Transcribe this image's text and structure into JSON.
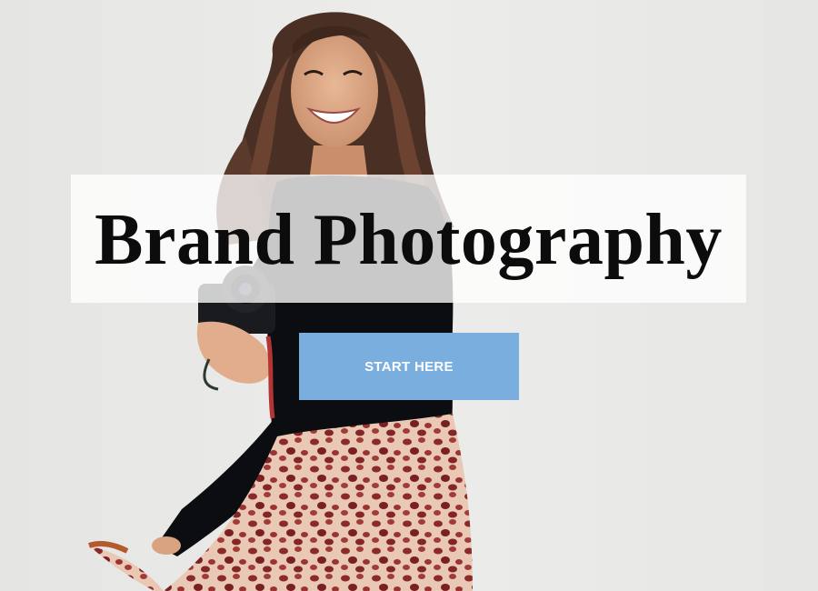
{
  "hero": {
    "title": "Brand Photography",
    "cta_label": "START HERE"
  },
  "colors": {
    "background": "#e8e8e6",
    "panel": "#ffffff",
    "button": "#7aaedf",
    "button_text": "#ffffff",
    "title_text": "#0c0c0c"
  }
}
